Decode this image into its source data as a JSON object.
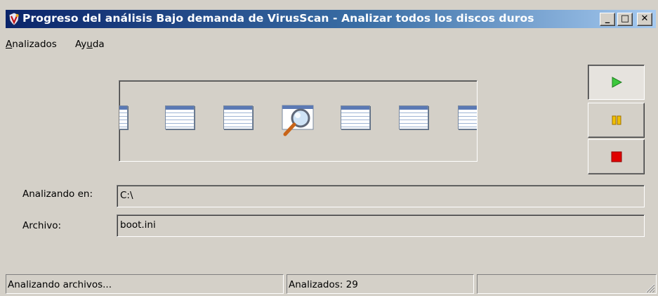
{
  "window": {
    "title": "Progreso del análisis Bajo demanda de VirusScan - Analizar todos los discos duros",
    "minimize_glyph": "_",
    "maximize_glyph": "□",
    "close_glyph": "✕"
  },
  "menu": [
    {
      "prefix": "",
      "accel": "A",
      "rest": "nalizados"
    },
    {
      "prefix": "Ay",
      "accel": "u",
      "rest": "da"
    }
  ],
  "animation": {
    "icons": [
      "document-icon",
      "document-icon",
      "document-icon",
      "magnifier-icon",
      "document-icon",
      "document-icon",
      "document-icon"
    ]
  },
  "controls": {
    "play": {
      "icon": "play-icon",
      "color": "#28b428"
    },
    "pause": {
      "icon": "pause-icon",
      "color": "#e6a800"
    },
    "stop": {
      "icon": "stop-icon",
      "color": "#e00000"
    }
  },
  "fields": {
    "scanning_label": "Analizando en:",
    "scanning_value": "C:\\",
    "file_label": "Archivo:",
    "file_value": "boot.ini"
  },
  "status": {
    "state": "Analizando archivos...",
    "scanned": "Analizados: 29",
    "extra": ""
  }
}
